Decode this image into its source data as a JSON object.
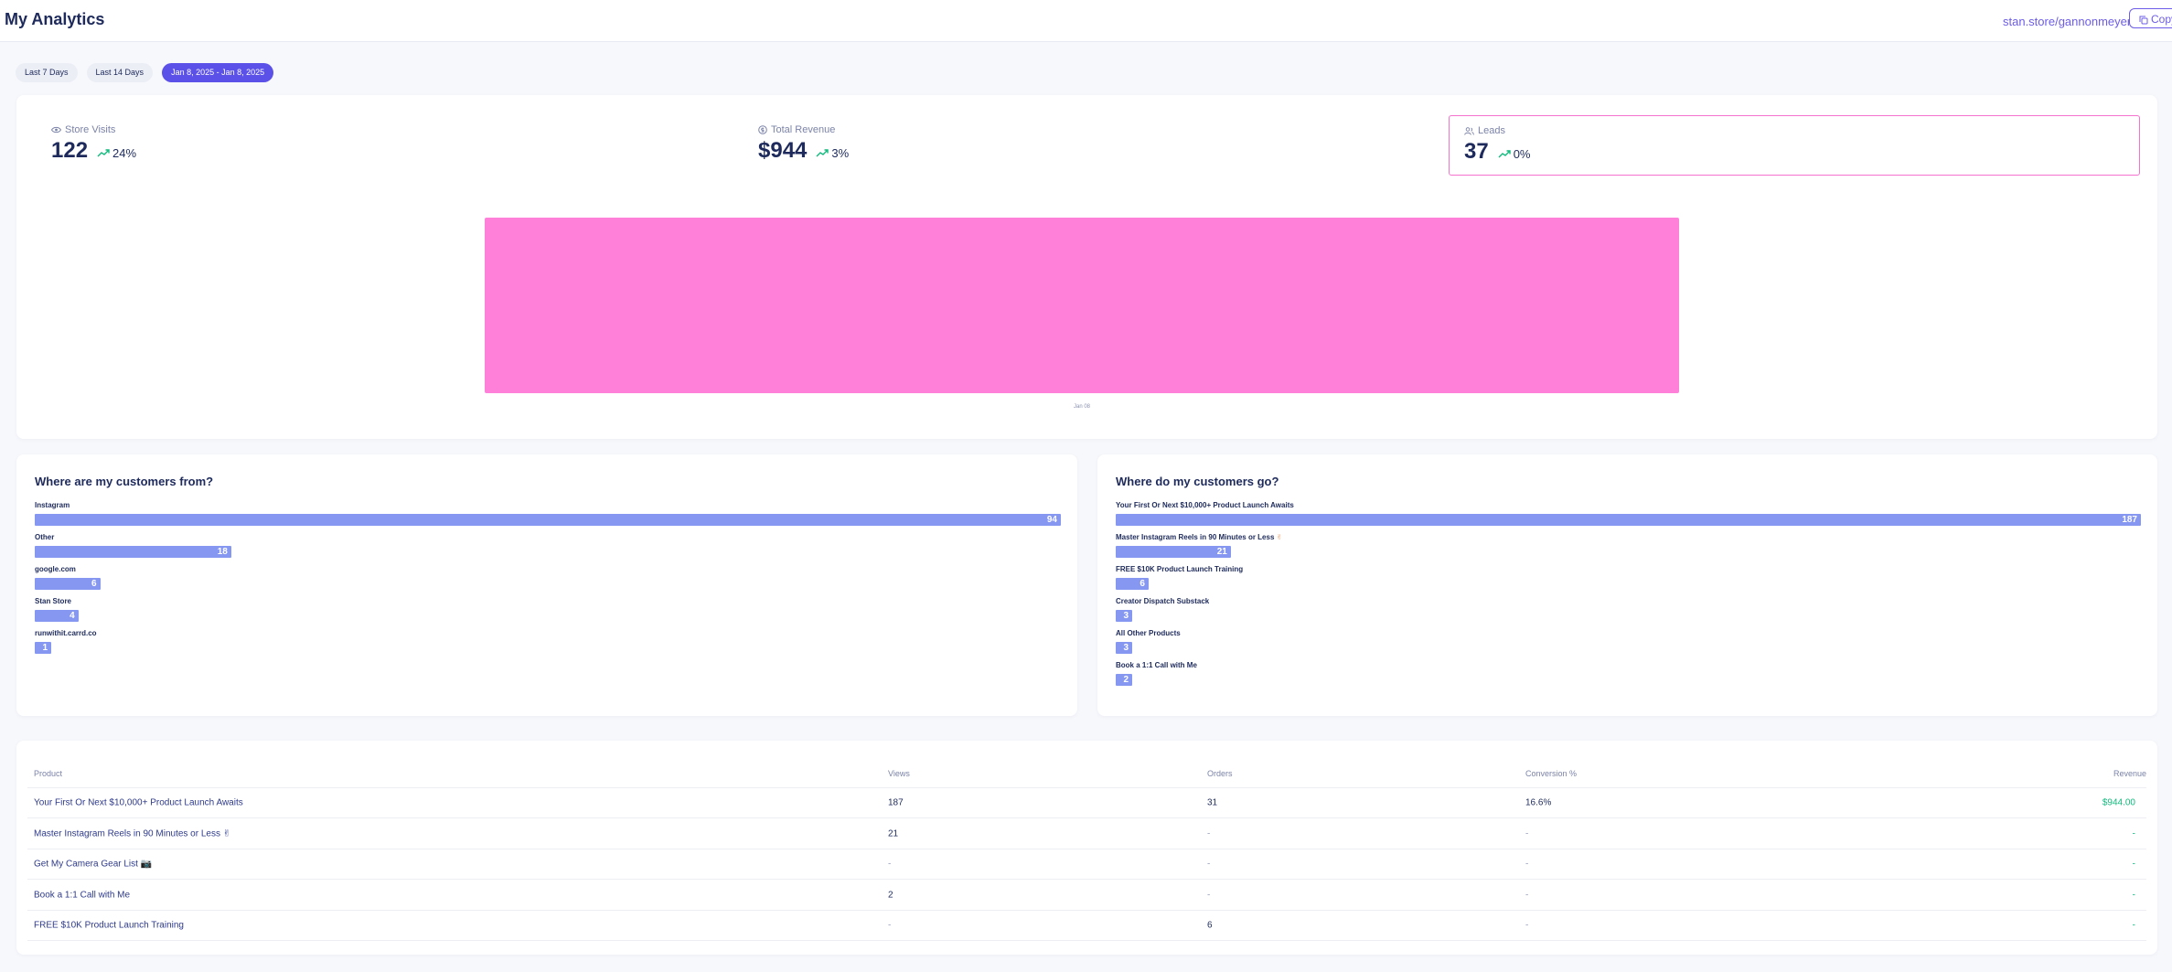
{
  "header": {
    "title": "My Analytics",
    "store_link": "stan.store/gannonmeyer",
    "copy_label": "Copy"
  },
  "filters": [
    {
      "label": "Last 7 Days",
      "active": false
    },
    {
      "label": "Last 14 Days",
      "active": false
    },
    {
      "label": "Jan 8, 2025 - Jan 8, 2025",
      "active": true
    }
  ],
  "stats": [
    {
      "label": "Store Visits",
      "icon": "eye-icon",
      "value": "122",
      "change": "24%",
      "selected": false
    },
    {
      "label": "Total Revenue",
      "icon": "dollar-circle-icon",
      "value": "$944",
      "change": "3%",
      "selected": false
    },
    {
      "label": "Leads",
      "icon": "users-icon",
      "value": "37",
      "change": "0%",
      "selected": true
    }
  ],
  "chart_data": {
    "type": "bar",
    "categories": [
      "Jan 08"
    ],
    "series": [
      {
        "values": [
          37
        ],
        "color": "#ff80d9"
      }
    ],
    "title": "",
    "xlabel": "",
    "ylabel": "",
    "ylim": [
      0,
      37
    ],
    "grid": false
  },
  "sources": {
    "title": "Where are my customers from?",
    "items": [
      {
        "label": "Instagram",
        "value": 94
      },
      {
        "label": "Other",
        "value": 18
      },
      {
        "label": "google.com",
        "value": 6
      },
      {
        "label": "Stan Store",
        "value": 4
      },
      {
        "label": "runwithit.carrd.co",
        "value": 1
      }
    ],
    "max": 94
  },
  "destinations": {
    "title": "Where do my customers go?",
    "items": [
      {
        "label": "Your First Or Next $10,000+ Product Launch Awaits",
        "value": 187
      },
      {
        "label": "Master Instagram Reels in 90 Minutes or Less",
        "emoji": "✌",
        "value": 21
      },
      {
        "label": "FREE $10K Product Launch Training",
        "value": 6
      },
      {
        "label": "Creator Dispatch Substack",
        "value": 3
      },
      {
        "label": "All Other Products",
        "value": 3
      },
      {
        "label": "Book a 1:1 Call with Me",
        "value": 2
      }
    ],
    "max": 187
  },
  "table": {
    "headers": {
      "product": "Product",
      "views": "Views",
      "orders": "Orders",
      "conversion": "Conversion %",
      "revenue": "Revenue"
    },
    "rows": [
      {
        "product": "Your First Or Next $10,000+ Product Launch Awaits",
        "views": "187",
        "orders": "31",
        "conversion": "16.6%",
        "revenue": "$944.00"
      },
      {
        "product": "Master Instagram Reels in 90 Minutes or Less ✌",
        "views": "21",
        "orders": "-",
        "conversion": "-",
        "revenue": "-"
      },
      {
        "product": "Get My Camera Gear List 📷",
        "views": "-",
        "orders": "-",
        "conversion": "-",
        "revenue": "-"
      },
      {
        "product": "Book a 1:1 Call with Me",
        "views": "2",
        "orders": "-",
        "conversion": "-",
        "revenue": "-"
      },
      {
        "product": "FREE $10K Product Launch Training",
        "views": "-",
        "orders": "6",
        "conversion": "-",
        "revenue": "-"
      }
    ]
  },
  "colors": {
    "accent": "#5b50e8",
    "chart_bar": "#ff80d9",
    "hbar": "#8697f2",
    "revenue": "#10b97c"
  }
}
